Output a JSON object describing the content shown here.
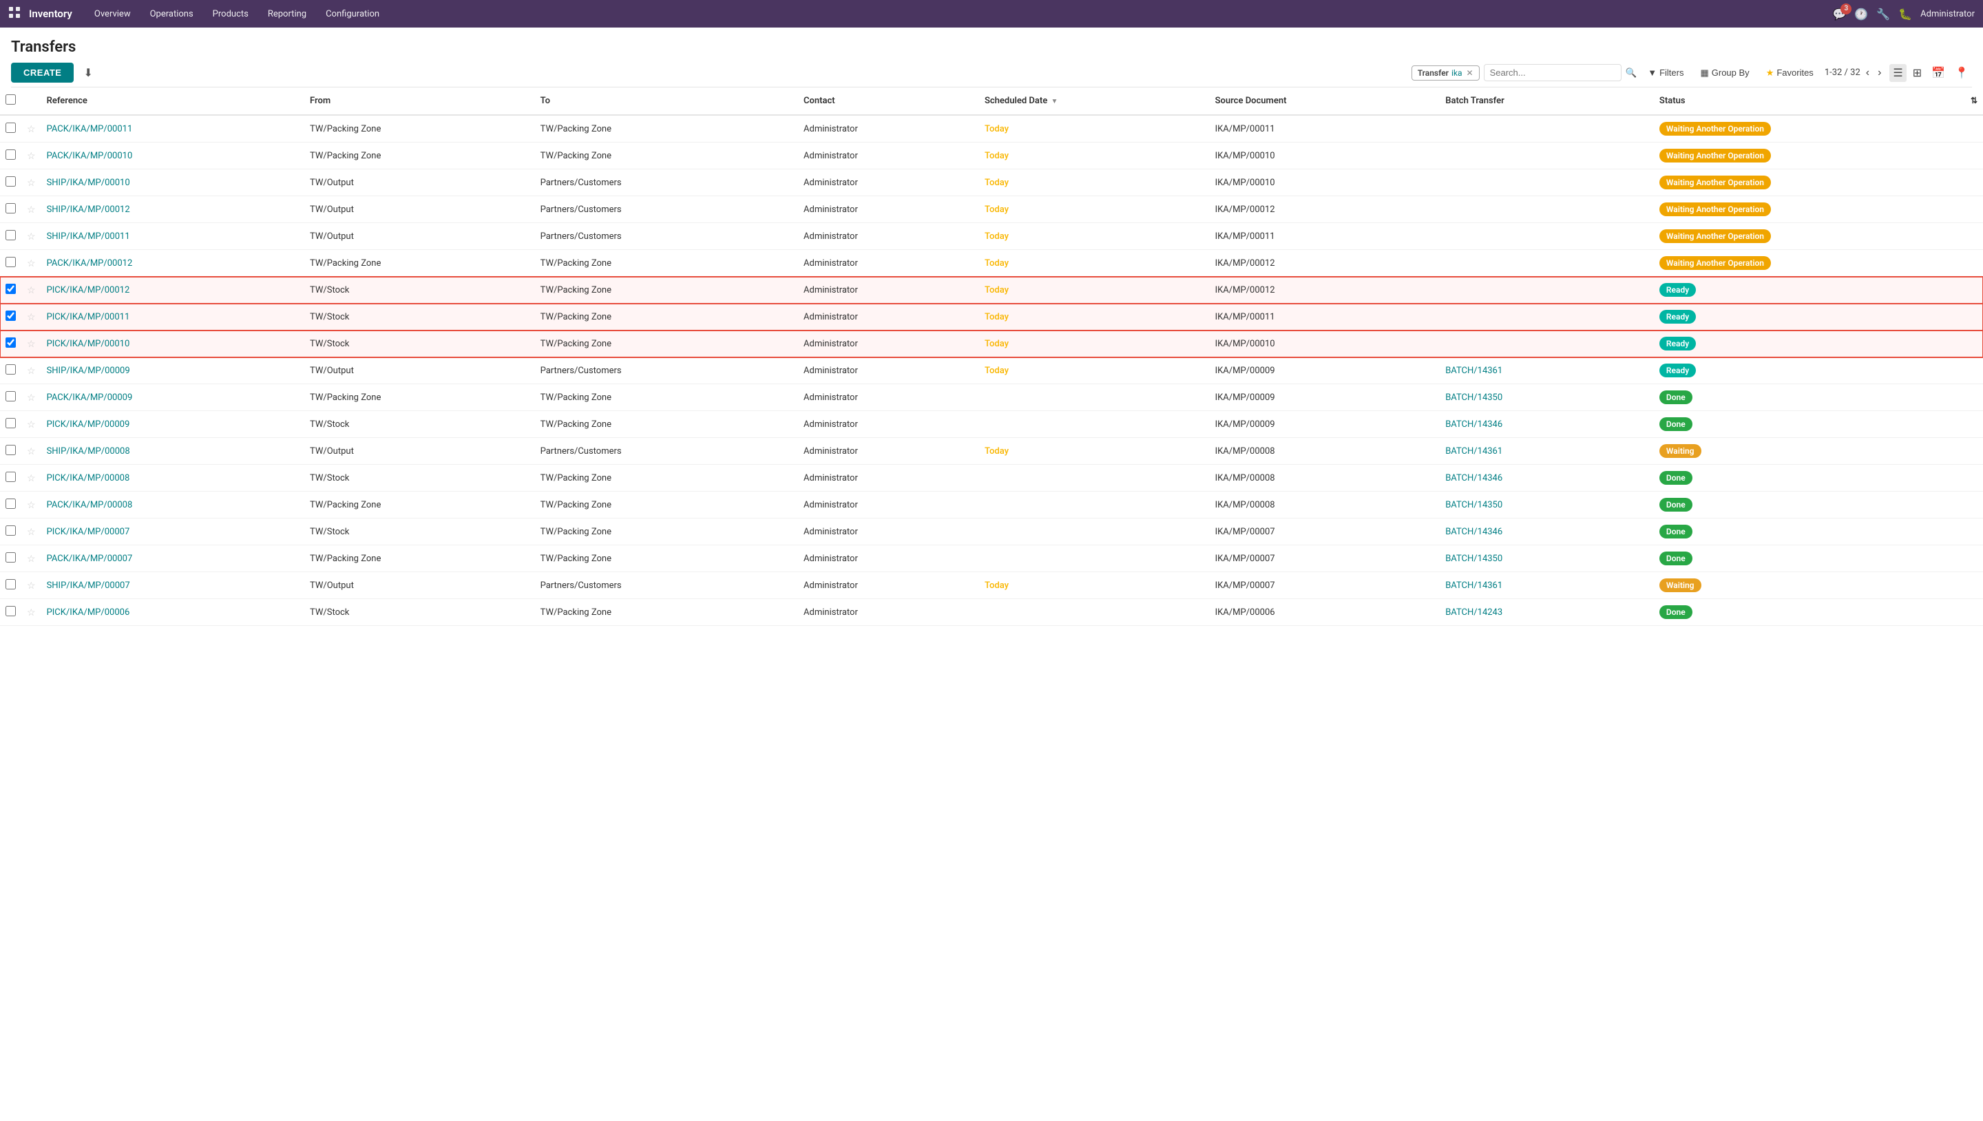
{
  "app": {
    "name": "Inventory",
    "nav_items": [
      "Overview",
      "Operations",
      "Products",
      "Reporting",
      "Configuration"
    ],
    "badge_count": "3",
    "user": "Administrator"
  },
  "page": {
    "title": "Transfers",
    "create_label": "CREATE",
    "filter_tag_name": "Transfer",
    "filter_tag_value": "ika",
    "search_placeholder": "Search...",
    "filters_label": "Filters",
    "group_by_label": "Group By",
    "favorites_label": "Favorites",
    "pagination": "1-32 / 32"
  },
  "table": {
    "columns": [
      "Reference",
      "From",
      "To",
      "Contact",
      "Scheduled Date",
      "Source Document",
      "Batch Transfer",
      "Status"
    ],
    "rows": [
      {
        "ref": "PACK/IKA/MP/00011",
        "from": "TW/Packing Zone",
        "to": "TW/Packing Zone",
        "contact": "Administrator",
        "date": "Today",
        "source": "IKA/MP/00011",
        "batch": "",
        "status": "Waiting Another Operation",
        "status_type": "waiting-op",
        "selected": false
      },
      {
        "ref": "PACK/IKA/MP/00010",
        "from": "TW/Packing Zone",
        "to": "TW/Packing Zone",
        "contact": "Administrator",
        "date": "Today",
        "source": "IKA/MP/00010",
        "batch": "",
        "status": "Waiting Another Operation",
        "status_type": "waiting-op",
        "selected": false
      },
      {
        "ref": "SHIP/IKA/MP/00010",
        "from": "TW/Output",
        "to": "Partners/Customers",
        "contact": "Administrator",
        "date": "Today",
        "source": "IKA/MP/00010",
        "batch": "",
        "status": "Waiting Another Operation",
        "status_type": "waiting-op",
        "selected": false
      },
      {
        "ref": "SHIP/IKA/MP/00012",
        "from": "TW/Output",
        "to": "Partners/Customers",
        "contact": "Administrator",
        "date": "Today",
        "source": "IKA/MP/00012",
        "batch": "",
        "status": "Waiting Another Operation",
        "status_type": "waiting-op",
        "selected": false
      },
      {
        "ref": "SHIP/IKA/MP/00011",
        "from": "TW/Output",
        "to": "Partners/Customers",
        "contact": "Administrator",
        "date": "Today",
        "source": "IKA/MP/00011",
        "batch": "",
        "status": "Waiting Another Operation",
        "status_type": "waiting-op",
        "selected": false
      },
      {
        "ref": "PACK/IKA/MP/00012",
        "from": "TW/Packing Zone",
        "to": "TW/Packing Zone",
        "contact": "Administrator",
        "date": "Today",
        "source": "IKA/MP/00012",
        "batch": "",
        "status": "Waiting Another Operation",
        "status_type": "waiting-op",
        "selected": false
      },
      {
        "ref": "PICK/IKA/MP/00012",
        "from": "TW/Stock",
        "to": "TW/Packing Zone",
        "contact": "Administrator",
        "date": "Today",
        "source": "IKA/MP/00012",
        "batch": "",
        "status": "Ready",
        "status_type": "ready",
        "selected": true
      },
      {
        "ref": "PICK/IKA/MP/00011",
        "from": "TW/Stock",
        "to": "TW/Packing Zone",
        "contact": "Administrator",
        "date": "Today",
        "source": "IKA/MP/00011",
        "batch": "",
        "status": "Ready",
        "status_type": "ready",
        "selected": true
      },
      {
        "ref": "PICK/IKA/MP/00010",
        "from": "TW/Stock",
        "to": "TW/Packing Zone",
        "contact": "Administrator",
        "date": "Today",
        "source": "IKA/MP/00010",
        "batch": "",
        "status": "Ready",
        "status_type": "ready",
        "selected": true
      },
      {
        "ref": "SHIP/IKA/MP/00009",
        "from": "TW/Output",
        "to": "Partners/Customers",
        "contact": "Administrator",
        "date": "Today",
        "source": "IKA/MP/00009",
        "batch": "BATCH/14361",
        "status": "Ready",
        "status_type": "ready",
        "selected": false
      },
      {
        "ref": "PACK/IKA/MP/00009",
        "from": "TW/Packing Zone",
        "to": "TW/Packing Zone",
        "contact": "Administrator",
        "date": "",
        "source": "IKA/MP/00009",
        "batch": "BATCH/14350",
        "status": "Done",
        "status_type": "done",
        "selected": false
      },
      {
        "ref": "PICK/IKA/MP/00009",
        "from": "TW/Stock",
        "to": "TW/Packing Zone",
        "contact": "Administrator",
        "date": "",
        "source": "IKA/MP/00009",
        "batch": "BATCH/14346",
        "status": "Done",
        "status_type": "done",
        "selected": false
      },
      {
        "ref": "SHIP/IKA/MP/00008",
        "from": "TW/Output",
        "to": "Partners/Customers",
        "contact": "Administrator",
        "date": "Today",
        "source": "IKA/MP/00008",
        "batch": "BATCH/14361",
        "status": "Waiting",
        "status_type": "waiting",
        "selected": false
      },
      {
        "ref": "PICK/IKA/MP/00008",
        "from": "TW/Stock",
        "to": "TW/Packing Zone",
        "contact": "Administrator",
        "date": "",
        "source": "IKA/MP/00008",
        "batch": "BATCH/14346",
        "status": "Done",
        "status_type": "done",
        "selected": false
      },
      {
        "ref": "PACK/IKA/MP/00008",
        "from": "TW/Packing Zone",
        "to": "TW/Packing Zone",
        "contact": "Administrator",
        "date": "",
        "source": "IKA/MP/00008",
        "batch": "BATCH/14350",
        "status": "Done",
        "status_type": "done",
        "selected": false
      },
      {
        "ref": "PICK/IKA/MP/00007",
        "from": "TW/Stock",
        "to": "TW/Packing Zone",
        "contact": "Administrator",
        "date": "",
        "source": "IKA/MP/00007",
        "batch": "BATCH/14346",
        "status": "Done",
        "status_type": "done",
        "selected": false
      },
      {
        "ref": "PACK/IKA/MP/00007",
        "from": "TW/Packing Zone",
        "to": "TW/Packing Zone",
        "contact": "Administrator",
        "date": "",
        "source": "IKA/MP/00007",
        "batch": "BATCH/14350",
        "status": "Done",
        "status_type": "done",
        "selected": false
      },
      {
        "ref": "SHIP/IKA/MP/00007",
        "from": "TW/Output",
        "to": "Partners/Customers",
        "contact": "Administrator",
        "date": "Today",
        "source": "IKA/MP/00007",
        "batch": "BATCH/14361",
        "status": "Waiting",
        "status_type": "waiting",
        "selected": false
      },
      {
        "ref": "PICK/IKA/MP/00006",
        "from": "TW/Stock",
        "to": "TW/Packing Zone",
        "contact": "Administrator",
        "date": "",
        "source": "IKA/MP/00006",
        "batch": "BATCH/14243",
        "status": "Done",
        "status_type": "done",
        "selected": false
      }
    ]
  }
}
